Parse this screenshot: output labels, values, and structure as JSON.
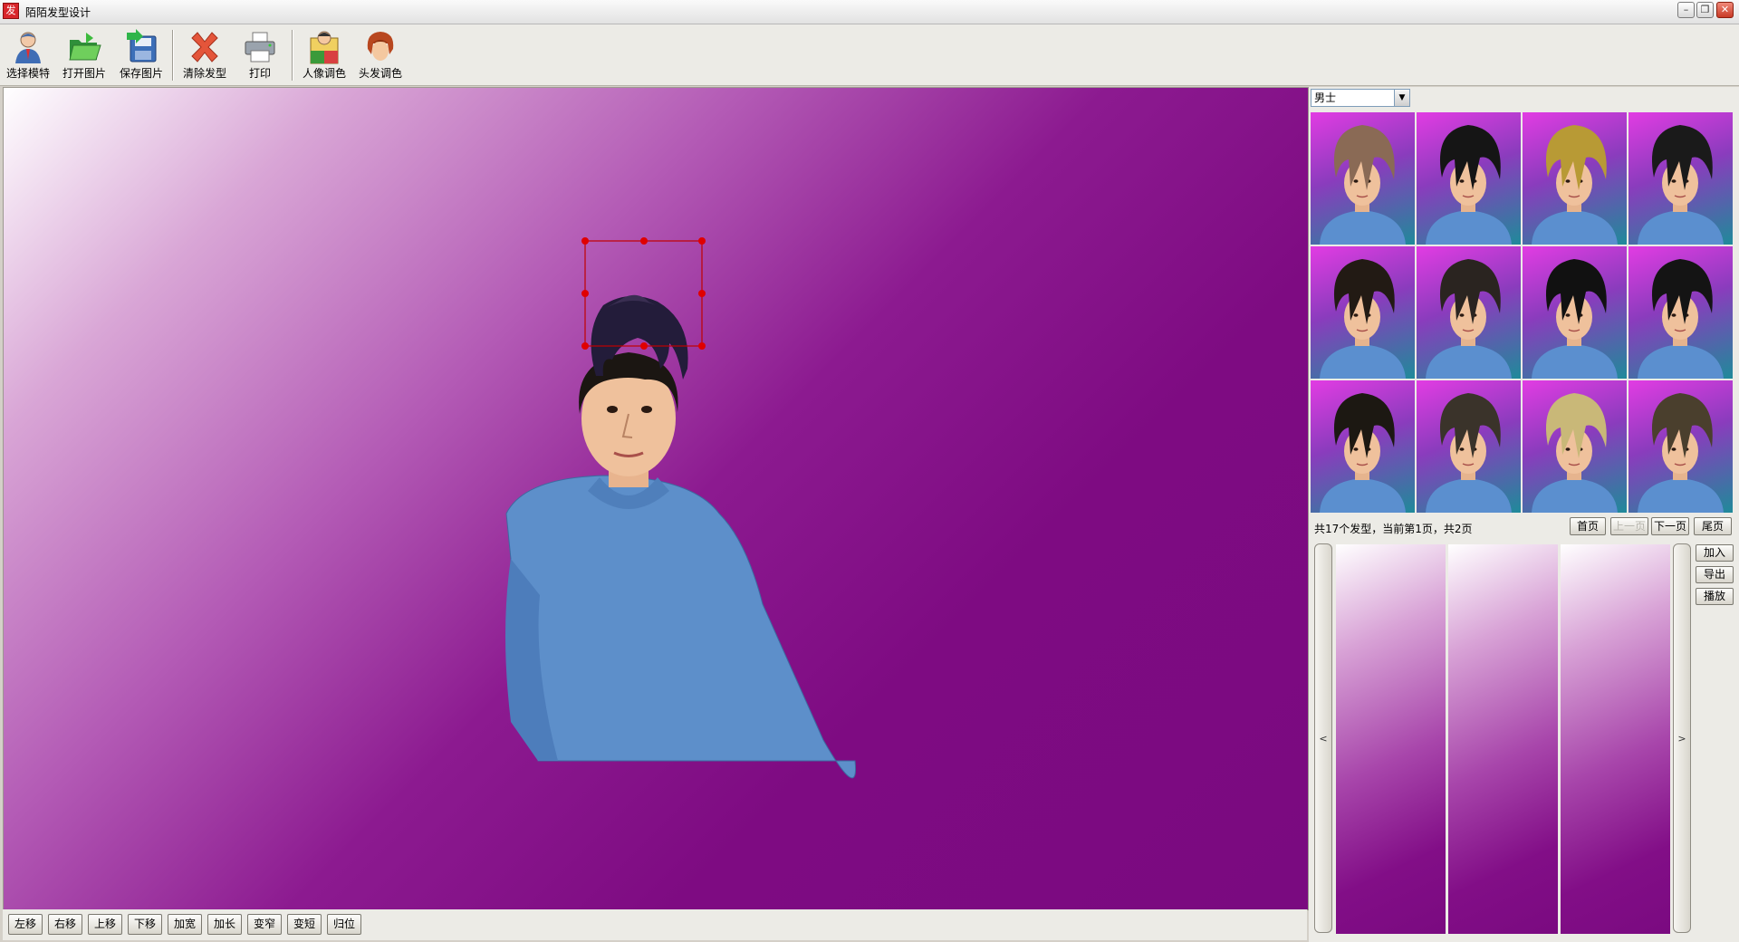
{
  "window": {
    "title": "陌陌发型设计",
    "icon_label": "发"
  },
  "window_controls": {
    "minimize": "–",
    "maximize": "❐",
    "close": "✕"
  },
  "toolbar": {
    "select_model": "选择模特",
    "open_image": "打开图片",
    "save_image": "保存图片",
    "clear_hairstyle": "清除发型",
    "print": "打印",
    "portrait_color": "人像调色",
    "hair_color": "头发调色"
  },
  "adjust_buttons": [
    "左移",
    "右移",
    "上移",
    "下移",
    "加宽",
    "加长",
    "变窄",
    "变短",
    "归位"
  ],
  "category": {
    "selected": "男士"
  },
  "thumbnails": [
    {
      "hair": "#8a6a55"
    },
    {
      "hair": "#151515"
    },
    {
      "hair": "#b89a35"
    },
    {
      "hair": "#1a1a1a"
    },
    {
      "hair": "#221a14"
    },
    {
      "hair": "#2a2420"
    },
    {
      "hair": "#111111"
    },
    {
      "hair": "#141414"
    },
    {
      "hair": "#1c1812"
    },
    {
      "hair": "#3a332a"
    },
    {
      "hair": "#c9b878"
    },
    {
      "hair": "#4a3f2d"
    }
  ],
  "pager": {
    "info": "共17个发型，当前第1页，共2页",
    "first": "首页",
    "prev": "上一页",
    "next": "下一页",
    "last": "尾页"
  },
  "strip": {
    "left_arrow": "<",
    "right_arrow": ">"
  },
  "side_buttons": {
    "add": "加入",
    "export": "导出",
    "play": "播放"
  },
  "colors": {
    "canvas_dark": "#7e0b82",
    "canvas_light": "#ffffff",
    "selection": "#d00000"
  }
}
